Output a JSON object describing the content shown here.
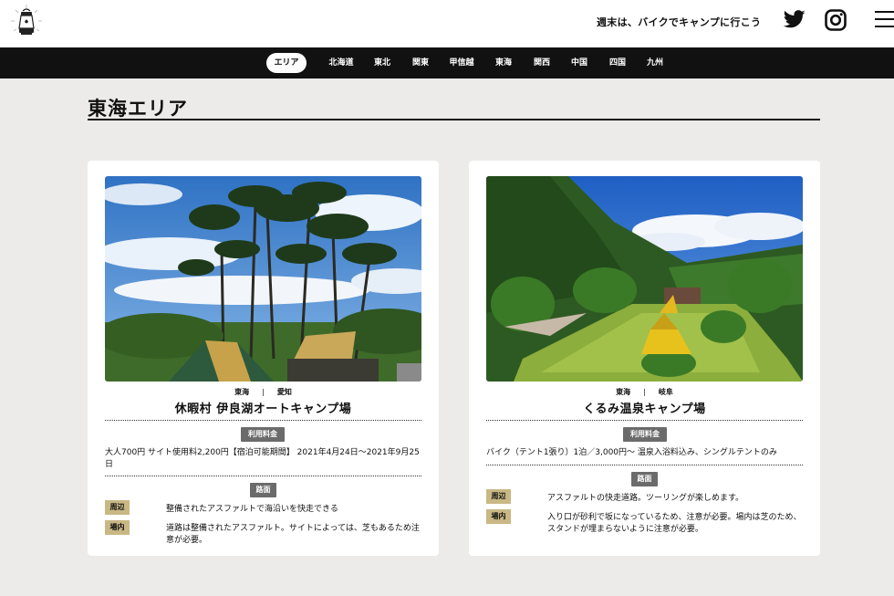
{
  "header": {
    "tagline": "週末は、バイクでキャンプに行こう",
    "logo_icon": "lantern-logo",
    "social": [
      "twitter-icon",
      "instagram-icon"
    ],
    "menu_icon": "hamburger-menu-icon"
  },
  "nav": {
    "items": [
      {
        "label": "エリア",
        "active": true
      },
      {
        "label": "北海道"
      },
      {
        "label": "東北"
      },
      {
        "label": "関東"
      },
      {
        "label": "甲信越"
      },
      {
        "label": "東海"
      },
      {
        "label": "関西"
      },
      {
        "label": "中国"
      },
      {
        "label": "四国"
      },
      {
        "label": "九州"
      }
    ]
  },
  "page": {
    "title": "東海エリア"
  },
  "cards": [
    {
      "region": "東海",
      "separator": "|",
      "prefecture": "愛知",
      "name": "休暇村 伊良湖オートキャンプ場",
      "fee_label": "利用料金",
      "fee_text": "大人700円 サイト使用料2,200円【宿泊可能期間】 2021年4月24日〜2021年9月25日",
      "road_label": "路面",
      "surroundings_tag": "周辺",
      "surroundings_text": "整備されたアスファルトで海沿いを快走できる",
      "inside_tag": "場内",
      "inside_text": "道路は整備されたアスファルト。サイトによっては、芝もあるため注意が必要。"
    },
    {
      "region": "東海",
      "separator": "|",
      "prefecture": "岐阜",
      "name": "くるみ温泉キャンプ場",
      "fee_label": "利用料金",
      "fee_text": "バイク（テント1張り）1泊／3,000円〜 温泉入浴料込み、シングルテントのみ",
      "road_label": "路面",
      "surroundings_tag": "周辺",
      "surroundings_text": "アスファルトの快走道路。ツーリングが楽しめます。",
      "inside_tag": "場内",
      "inside_text": "入り口が砂利で坂になっているため、注意が必要。場内は芝のため、スタンドが埋まらないように注意が必要。"
    }
  ]
}
